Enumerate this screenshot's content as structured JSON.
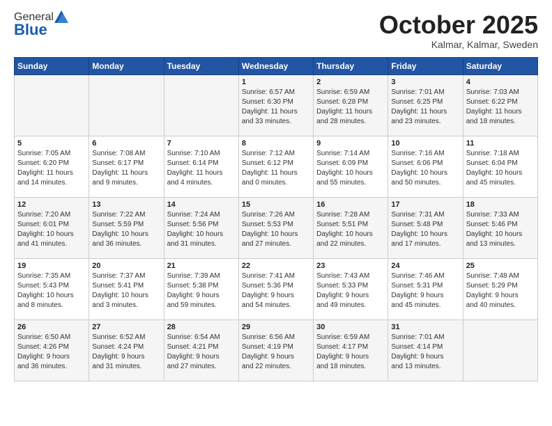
{
  "header": {
    "logo": {
      "part1": "General",
      "part2": "Blue"
    },
    "title": "October 2025",
    "subtitle": "Kalmar, Kalmar, Sweden"
  },
  "days_of_week": [
    "Sunday",
    "Monday",
    "Tuesday",
    "Wednesday",
    "Thursday",
    "Friday",
    "Saturday"
  ],
  "weeks": [
    [
      {
        "num": "",
        "info": ""
      },
      {
        "num": "",
        "info": ""
      },
      {
        "num": "",
        "info": ""
      },
      {
        "num": "1",
        "info": "Sunrise: 6:57 AM\nSunset: 6:30 PM\nDaylight: 11 hours\nand 33 minutes."
      },
      {
        "num": "2",
        "info": "Sunrise: 6:59 AM\nSunset: 6:28 PM\nDaylight: 11 hours\nand 28 minutes."
      },
      {
        "num": "3",
        "info": "Sunrise: 7:01 AM\nSunset: 6:25 PM\nDaylight: 11 hours\nand 23 minutes."
      },
      {
        "num": "4",
        "info": "Sunrise: 7:03 AM\nSunset: 6:22 PM\nDaylight: 11 hours\nand 18 minutes."
      }
    ],
    [
      {
        "num": "5",
        "info": "Sunrise: 7:05 AM\nSunset: 6:20 PM\nDaylight: 11 hours\nand 14 minutes."
      },
      {
        "num": "6",
        "info": "Sunrise: 7:08 AM\nSunset: 6:17 PM\nDaylight: 11 hours\nand 9 minutes."
      },
      {
        "num": "7",
        "info": "Sunrise: 7:10 AM\nSunset: 6:14 PM\nDaylight: 11 hours\nand 4 minutes."
      },
      {
        "num": "8",
        "info": "Sunrise: 7:12 AM\nSunset: 6:12 PM\nDaylight: 11 hours\nand 0 minutes."
      },
      {
        "num": "9",
        "info": "Sunrise: 7:14 AM\nSunset: 6:09 PM\nDaylight: 10 hours\nand 55 minutes."
      },
      {
        "num": "10",
        "info": "Sunrise: 7:16 AM\nSunset: 6:06 PM\nDaylight: 10 hours\nand 50 minutes."
      },
      {
        "num": "11",
        "info": "Sunrise: 7:18 AM\nSunset: 6:04 PM\nDaylight: 10 hours\nand 45 minutes."
      }
    ],
    [
      {
        "num": "12",
        "info": "Sunrise: 7:20 AM\nSunset: 6:01 PM\nDaylight: 10 hours\nand 41 minutes."
      },
      {
        "num": "13",
        "info": "Sunrise: 7:22 AM\nSunset: 5:59 PM\nDaylight: 10 hours\nand 36 minutes."
      },
      {
        "num": "14",
        "info": "Sunrise: 7:24 AM\nSunset: 5:56 PM\nDaylight: 10 hours\nand 31 minutes."
      },
      {
        "num": "15",
        "info": "Sunrise: 7:26 AM\nSunset: 5:53 PM\nDaylight: 10 hours\nand 27 minutes."
      },
      {
        "num": "16",
        "info": "Sunrise: 7:28 AM\nSunset: 5:51 PM\nDaylight: 10 hours\nand 22 minutes."
      },
      {
        "num": "17",
        "info": "Sunrise: 7:31 AM\nSunset: 5:48 PM\nDaylight: 10 hours\nand 17 minutes."
      },
      {
        "num": "18",
        "info": "Sunrise: 7:33 AM\nSunset: 5:46 PM\nDaylight: 10 hours\nand 13 minutes."
      }
    ],
    [
      {
        "num": "19",
        "info": "Sunrise: 7:35 AM\nSunset: 5:43 PM\nDaylight: 10 hours\nand 8 minutes."
      },
      {
        "num": "20",
        "info": "Sunrise: 7:37 AM\nSunset: 5:41 PM\nDaylight: 10 hours\nand 3 minutes."
      },
      {
        "num": "21",
        "info": "Sunrise: 7:39 AM\nSunset: 5:38 PM\nDaylight: 9 hours\nand 59 minutes."
      },
      {
        "num": "22",
        "info": "Sunrise: 7:41 AM\nSunset: 5:36 PM\nDaylight: 9 hours\nand 54 minutes."
      },
      {
        "num": "23",
        "info": "Sunrise: 7:43 AM\nSunset: 5:33 PM\nDaylight: 9 hours\nand 49 minutes."
      },
      {
        "num": "24",
        "info": "Sunrise: 7:46 AM\nSunset: 5:31 PM\nDaylight: 9 hours\nand 45 minutes."
      },
      {
        "num": "25",
        "info": "Sunrise: 7:48 AM\nSunset: 5:29 PM\nDaylight: 9 hours\nand 40 minutes."
      }
    ],
    [
      {
        "num": "26",
        "info": "Sunrise: 6:50 AM\nSunset: 4:26 PM\nDaylight: 9 hours\nand 36 minutes."
      },
      {
        "num": "27",
        "info": "Sunrise: 6:52 AM\nSunset: 4:24 PM\nDaylight: 9 hours\nand 31 minutes."
      },
      {
        "num": "28",
        "info": "Sunrise: 6:54 AM\nSunset: 4:21 PM\nDaylight: 9 hours\nand 27 minutes."
      },
      {
        "num": "29",
        "info": "Sunrise: 6:56 AM\nSunset: 4:19 PM\nDaylight: 9 hours\nand 22 minutes."
      },
      {
        "num": "30",
        "info": "Sunrise: 6:59 AM\nSunset: 4:17 PM\nDaylight: 9 hours\nand 18 minutes."
      },
      {
        "num": "31",
        "info": "Sunrise: 7:01 AM\nSunset: 4:14 PM\nDaylight: 9 hours\nand 13 minutes."
      },
      {
        "num": "",
        "info": ""
      }
    ]
  ]
}
